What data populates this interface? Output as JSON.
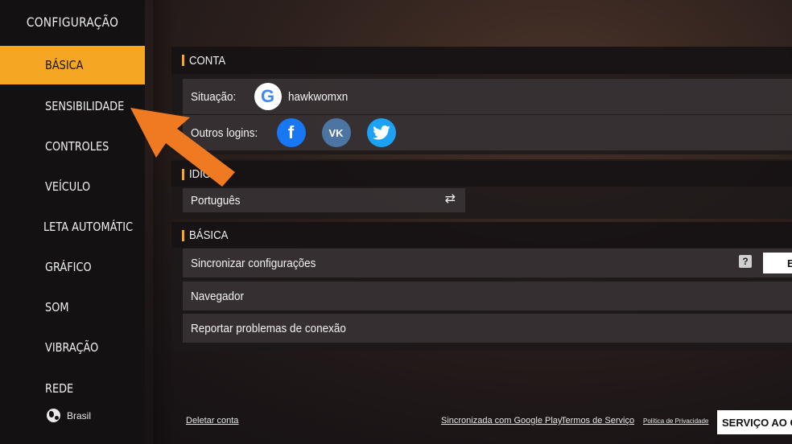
{
  "sidebar": {
    "title": "CONFIGURAÇÃO",
    "items": [
      {
        "label": "BÁSICA",
        "active": true
      },
      {
        "label": "SENSIBILIDADE",
        "active": false
      },
      {
        "label": "CONTROLES",
        "active": false
      },
      {
        "label": "VEÍCULO",
        "active": false
      },
      {
        "label": "LETA AUTOMÁTIC",
        "active": false
      },
      {
        "label": "GRÁFICO",
        "active": false
      },
      {
        "label": "SOM",
        "active": false
      },
      {
        "label": "VIBRAÇÃO",
        "active": false
      },
      {
        "label": "REDE",
        "active": false
      }
    ],
    "region": "Brasil",
    "region_icon": "globe-icon"
  },
  "conta": {
    "title": "CONTA",
    "status_label": "Situação:",
    "status_provider_icon": "google-icon",
    "google_letter": "G",
    "username": "hawkwomxn",
    "other_logins_label": "Outros logins:",
    "other_logins": [
      {
        "icon": "facebook-icon",
        "glyph": "f",
        "color": "#1877f2"
      },
      {
        "icon": "vk-icon",
        "glyph": "VK",
        "color": "#4c75a3"
      },
      {
        "icon": "twitter-icon",
        "glyph": "🐦",
        "color": "#1da1f2"
      }
    ]
  },
  "idioma": {
    "title": "IDIO",
    "value": "Português",
    "swap_icon": "swap-icon",
    "swap_glyph": "⇄"
  },
  "basica": {
    "title": "BÁSICA",
    "rows": [
      {
        "label": "Sincronizar configurações"
      },
      {
        "label": "Navegador"
      },
      {
        "label": "Reportar problemas de conexão"
      }
    ],
    "help_glyph": "?",
    "toggle_partial_text": "E"
  },
  "footer": {
    "delete_account": "Deletar conta",
    "sync_google_play": "Sincronizada com Google Play",
    "terms": "Termos de Serviço",
    "privacy": "Política de Privacidade",
    "service_button": "SERVIÇO AO CL"
  },
  "colors": {
    "accent": "#f5a623",
    "arrow": "#f07a22"
  }
}
